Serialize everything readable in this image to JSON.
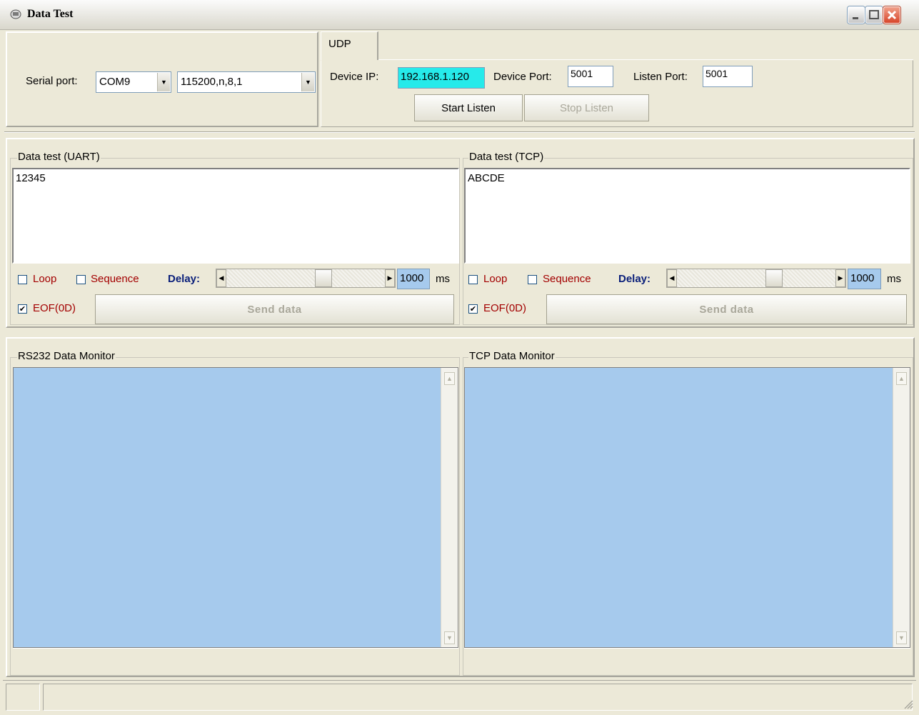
{
  "window": {
    "title": "Data Test"
  },
  "serial": {
    "label": "Serial port:",
    "port_value": "COM9",
    "settings_value": "115200,n,8,1"
  },
  "udp": {
    "tab_label": "UDP",
    "device_ip_label": "Device IP:",
    "device_ip_value": "192.168.1.120",
    "device_port_label": "Device Port:",
    "device_port_value": "5001",
    "listen_port_label": "Listen Port:",
    "listen_port_value": "5001",
    "start_label": "Start Listen",
    "stop_label": "Stop Listen"
  },
  "uart": {
    "group_label": "Data test (UART)",
    "text": "12345",
    "loop_label": "Loop",
    "loop_checked": false,
    "sequence_label": "Sequence",
    "sequence_checked": false,
    "delay_label": "Delay:",
    "delay_value": "1000",
    "delay_unit": "ms",
    "eof_label": "EOF(0D)",
    "eof_checked": true,
    "send_label": "Send data"
  },
  "tcp": {
    "group_label": "Data test (TCP)",
    "text": "ABCDE",
    "loop_label": "Loop",
    "loop_checked": false,
    "sequence_label": "Sequence",
    "sequence_checked": false,
    "delay_label": "Delay:",
    "delay_value": "1000",
    "delay_unit": "ms",
    "eof_label": "EOF(0D)",
    "eof_checked": true,
    "send_label": "Send data"
  },
  "monitors": {
    "rs232_label": "RS232 Data Monitor",
    "tcp_label": "TCP Data Monitor",
    "background": "#a6caed"
  },
  "icons": {
    "checkmark": "✔",
    "arrow_left": "◀",
    "arrow_right": "▶",
    "arrow_up": "▲",
    "arrow_down": "▼"
  }
}
